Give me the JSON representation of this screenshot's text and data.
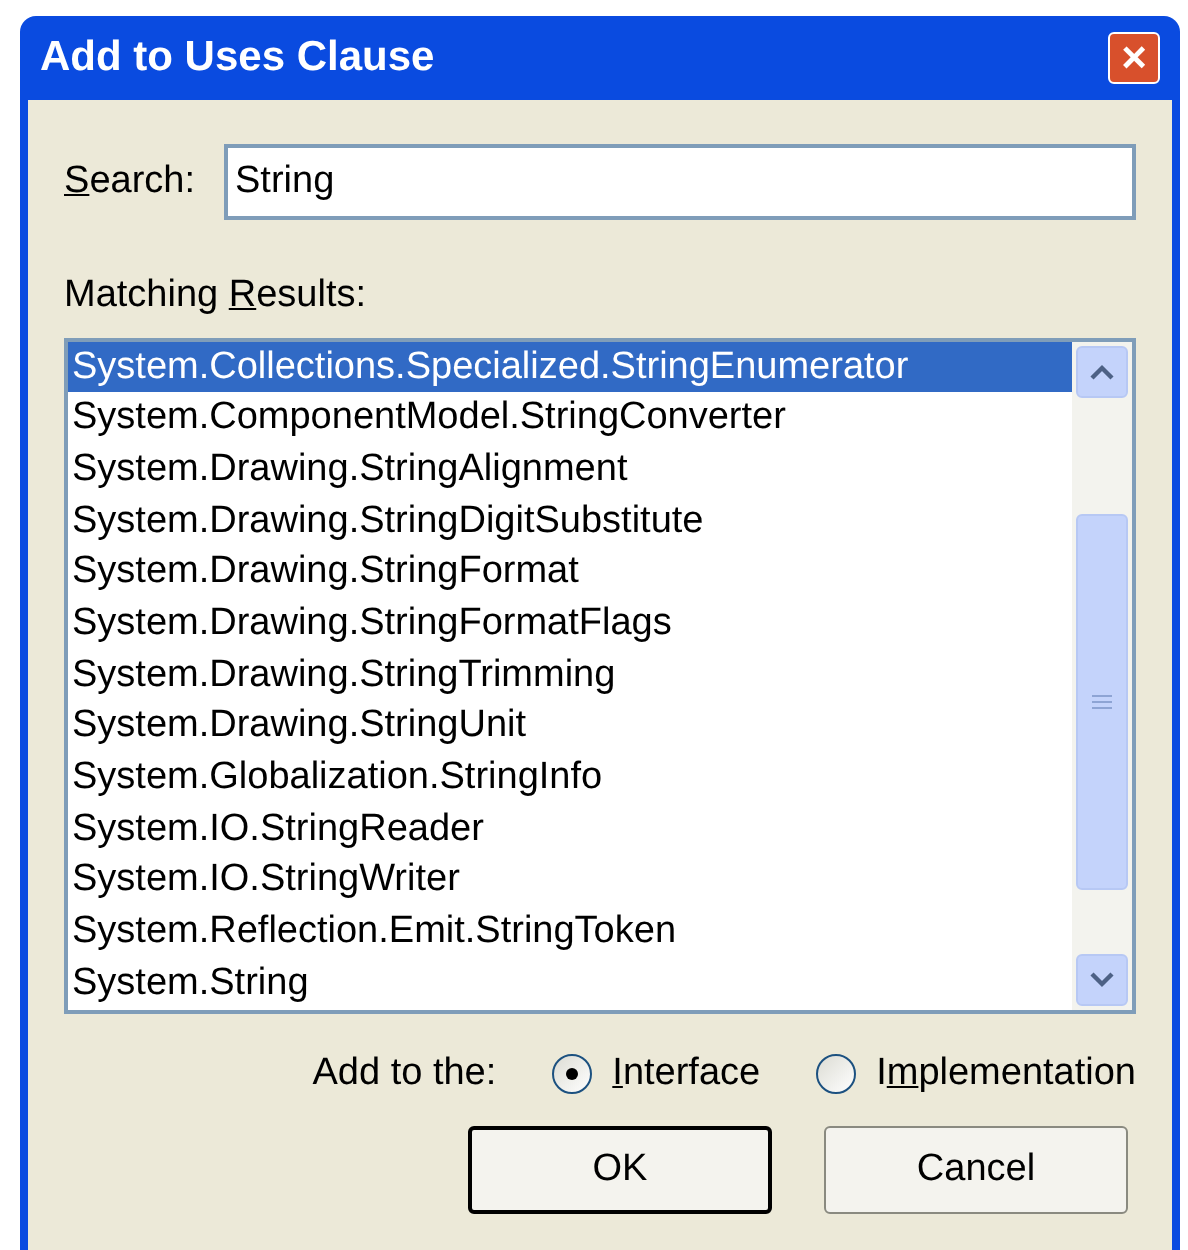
{
  "window": {
    "title": "Add to Uses Clause",
    "close": "×"
  },
  "search": {
    "label": {
      "key": "S",
      "after": "earch:"
    },
    "value": "String"
  },
  "results": {
    "label": {
      "before": "Matching ",
      "key": "R",
      "after": "esults:"
    },
    "items": [
      {
        "text": "System.Collections.Specialized.StringEnumerator",
        "selected": true
      },
      {
        "text": "System.ComponentModel.StringConverter",
        "selected": false
      },
      {
        "text": "System.Drawing.StringAlignment",
        "selected": false
      },
      {
        "text": "System.Drawing.StringDigitSubstitute",
        "selected": false
      },
      {
        "text": "System.Drawing.StringFormat",
        "selected": false
      },
      {
        "text": "System.Drawing.StringFormatFlags",
        "selected": false
      },
      {
        "text": "System.Drawing.StringTrimming",
        "selected": false
      },
      {
        "text": "System.Drawing.StringUnit",
        "selected": false
      },
      {
        "text": "System.Globalization.StringInfo",
        "selected": false
      },
      {
        "text": "System.IO.StringReader",
        "selected": false
      },
      {
        "text": "System.IO.StringWriter",
        "selected": false
      },
      {
        "text": "System.Reflection.Emit.StringToken",
        "selected": false
      },
      {
        "text": "System.String",
        "selected": false
      }
    ]
  },
  "add_to": {
    "label": "Add to the:",
    "options": [
      {
        "label": {
          "key": "I",
          "after": "nterface"
        },
        "selected": true
      },
      {
        "label": {
          "before": "I",
          "key": "m",
          "after": "plementation"
        },
        "selected": false
      }
    ]
  },
  "buttons": [
    {
      "label": "OK",
      "default": true
    },
    {
      "label": "Cancel",
      "default": false
    }
  ]
}
